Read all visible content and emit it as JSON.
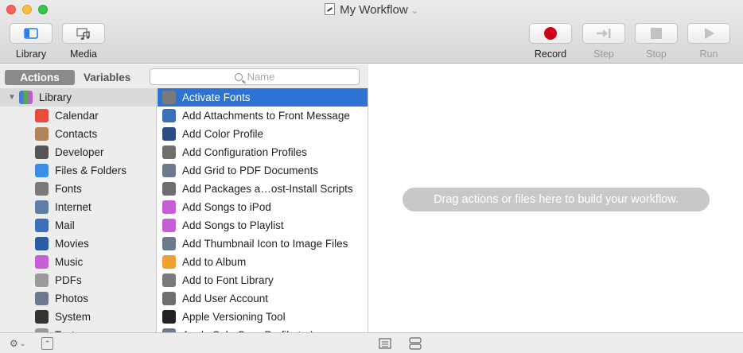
{
  "window": {
    "title": "My Workflow"
  },
  "toolbar": {
    "library_label": "Library",
    "media_label": "Media",
    "record_label": "Record",
    "step_label": "Step",
    "stop_label": "Stop",
    "run_label": "Run"
  },
  "tabs": {
    "actions": "Actions",
    "variables": "Variables"
  },
  "search": {
    "placeholder": "Name"
  },
  "library": {
    "root": "Library",
    "items": [
      {
        "label": "Calendar",
        "icon": "calendar-icon",
        "color": "#e94b3c"
      },
      {
        "label": "Contacts",
        "icon": "contacts-icon",
        "color": "#b0845a"
      },
      {
        "label": "Developer",
        "icon": "tools-icon",
        "color": "#555555"
      },
      {
        "label": "Files & Folders",
        "icon": "finder-icon",
        "color": "#3a8ee6"
      },
      {
        "label": "Fonts",
        "icon": "font-book-icon",
        "color": "#7a7a7a"
      },
      {
        "label": "Internet",
        "icon": "globe-icon",
        "color": "#5d7fa6"
      },
      {
        "label": "Mail",
        "icon": "mail-icon",
        "color": "#3b6fb6"
      },
      {
        "label": "Movies",
        "icon": "quicktime-icon",
        "color": "#2b5c9e"
      },
      {
        "label": "Music",
        "icon": "music-icon",
        "color": "#c55fd3"
      },
      {
        "label": "PDFs",
        "icon": "pdf-icon",
        "color": "#9a9a9a"
      },
      {
        "label": "Photos",
        "icon": "photos-icon",
        "color": "#6b7a8c"
      },
      {
        "label": "System",
        "icon": "system-icon",
        "color": "#333333"
      },
      {
        "label": "Text",
        "icon": "text-icon",
        "color": "#999999"
      }
    ]
  },
  "actions": [
    {
      "label": "Activate Fonts",
      "icon": "font-book-icon",
      "color": "#7a7a7a"
    },
    {
      "label": "Add Attachments to Front Message",
      "icon": "mail-icon",
      "color": "#3b6fb6"
    },
    {
      "label": "Add Color Profile",
      "icon": "colorsync-icon",
      "color": "#2c4d84"
    },
    {
      "label": "Add Configuration Profiles",
      "icon": "automator-icon",
      "color": "#6e6e6e"
    },
    {
      "label": "Add Grid to PDF Documents",
      "icon": "preview-icon",
      "color": "#6b7a8c"
    },
    {
      "label": "Add Packages a…ost-Install Scripts",
      "icon": "automator-icon",
      "color": "#6e6e6e"
    },
    {
      "label": "Add Songs to iPod",
      "icon": "music-icon",
      "color": "#c55fd3"
    },
    {
      "label": "Add Songs to Playlist",
      "icon": "music-icon",
      "color": "#c55fd3"
    },
    {
      "label": "Add Thumbnail Icon to Image Files",
      "icon": "preview-icon",
      "color": "#6b7a8c"
    },
    {
      "label": "Add to Album",
      "icon": "photos-icon",
      "color": "#f0a030"
    },
    {
      "label": "Add to Font Library",
      "icon": "font-book-icon",
      "color": "#7a7a7a"
    },
    {
      "label": "Add User Account",
      "icon": "automator-icon",
      "color": "#6e6e6e"
    },
    {
      "label": "Apple Versioning Tool",
      "icon": "terminal-icon",
      "color": "#222222"
    },
    {
      "label": "Apply ColorSync Profile to I…",
      "icon": "preview-icon",
      "color": "#6b7a8c"
    }
  ],
  "workflow": {
    "hint": "Drag actions or files here to build your workflow."
  }
}
